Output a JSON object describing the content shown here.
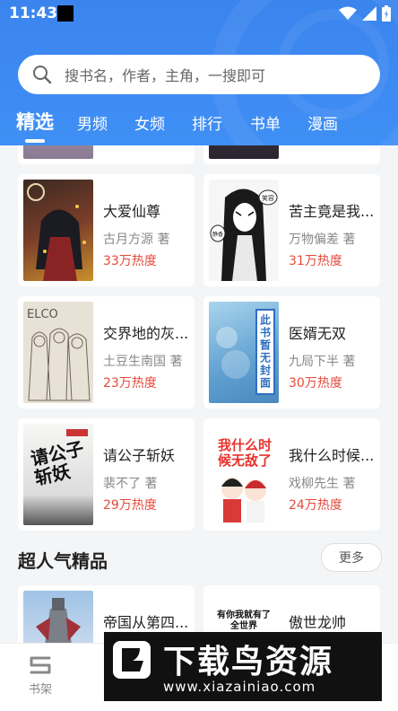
{
  "status": {
    "time": "11:43"
  },
  "search": {
    "placeholder": "搜书名，作者，主角，一搜即可"
  },
  "tabs": [
    "精选",
    "男频",
    "女频",
    "排行",
    "书单",
    "漫画"
  ],
  "books": [
    {
      "title": "大爱仙尊",
      "author": "古月方源 著",
      "heat": "33万热度",
      "cover": "dark-fantasy-girl"
    },
    {
      "title": "苦主竟是我...",
      "author": "万物偏差 著",
      "heat": "31万热度",
      "cover": "manga-black-hair"
    },
    {
      "title": "交界地的灰...",
      "author": "土豆生南国 著",
      "heat": "23万热度",
      "cover": "sketch-group"
    },
    {
      "title": "医婿无双",
      "author": "九局下半 著",
      "heat": "30万热度",
      "cover": "no-cover"
    },
    {
      "title": "请公子斩妖",
      "author": "裴不了 著",
      "heat": "29万热度",
      "cover": "ink-calligraphy"
    },
    {
      "title": "我什么时候...",
      "author": "戏柳先生 著",
      "heat": "24万热度",
      "cover": "red-chibi"
    }
  ],
  "covers": {
    "no_cover_text": "此书暂无封面",
    "ink_text": "请公子斩妖",
    "red_text": "我什么时候无敌了",
    "sketch_text": "ELCO",
    "manga_text": "笑容",
    "manga_text2": "静香"
  },
  "section": {
    "title": "超人气精品",
    "more_label": "更多"
  },
  "section_books": [
    {
      "title": "帝国从第四...",
      "cover": "mech"
    },
    {
      "title": "傲世龙帅",
      "cover": "white-text",
      "cover_text": "有你我就有了全世界"
    }
  ],
  "bottom_nav": {
    "shelf_label": "书架"
  },
  "watermark": {
    "main": "下载鸟资源",
    "url": "www.xiazainiao.com"
  },
  "colors": {
    "accent": "#3f8ff5",
    "heat": "#e64a3b"
  }
}
